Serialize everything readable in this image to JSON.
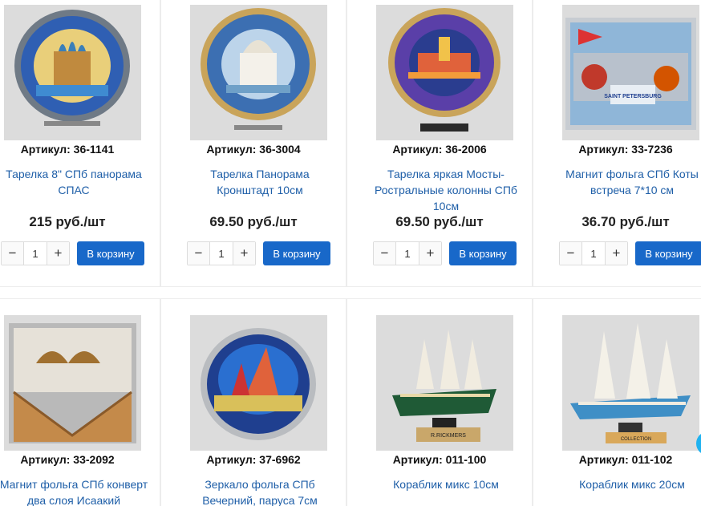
{
  "products": [
    {
      "sku": "Артикул: 36-1141",
      "name": "Тарелка 8\" СПб панорама СПАС",
      "price": "215 руб./шт",
      "qty": "1",
      "cart": "В корзину",
      "image": "plate-savior-on-blood"
    },
    {
      "sku": "Артикул: 36-3004",
      "name": "Тарелка Панорама Кронштадт 10см",
      "price": "69.50 руб./шт",
      "qty": "1",
      "cart": "В корзину",
      "image": "plate-kronstadt"
    },
    {
      "sku": "Артикул: 36-2006",
      "name": "Тарелка яркая Мосты-Ростральные колонны СПб 10см",
      "price": "69.50 руб./шт",
      "qty": "1",
      "cart": "В корзину",
      "image": "plate-bridges"
    },
    {
      "sku": "Артикул: 33-7236",
      "name": "Магнит фольга СПб Коты встреча 7*10 см",
      "price": "36.70 руб./шт",
      "qty": "1",
      "cart": "В корзину",
      "image": "magnet-cats"
    },
    {
      "sku": "Артикул: 33-2092",
      "name": "Магнит фольга СПб конверт два слоя Исаакий",
      "image": "magnet-envelope"
    },
    {
      "sku": "Артикул: 37-6962",
      "name": "Зеркало фольга СПб Вечерний, паруса 7см",
      "image": "mirror-sails"
    },
    {
      "sku": "Артикул: 011-100",
      "name": "Кораблик микс 10см",
      "image": "ship-green"
    },
    {
      "sku": "Артикул: 011-102",
      "name": "Кораблик микс 20см",
      "image": "ship-blue"
    }
  ],
  "controls": {
    "minus": "−",
    "plus": "+"
  },
  "image_text": {
    "magnet_banner": "SAINT PETERSBURG",
    "ship_plaque": "R.RICKMERS",
    "ship_plaque_2": "COLLECTION"
  },
  "colors": {
    "link": "#1f5fa8",
    "button": "#1868c9",
    "fab": "#1fb2f0"
  }
}
